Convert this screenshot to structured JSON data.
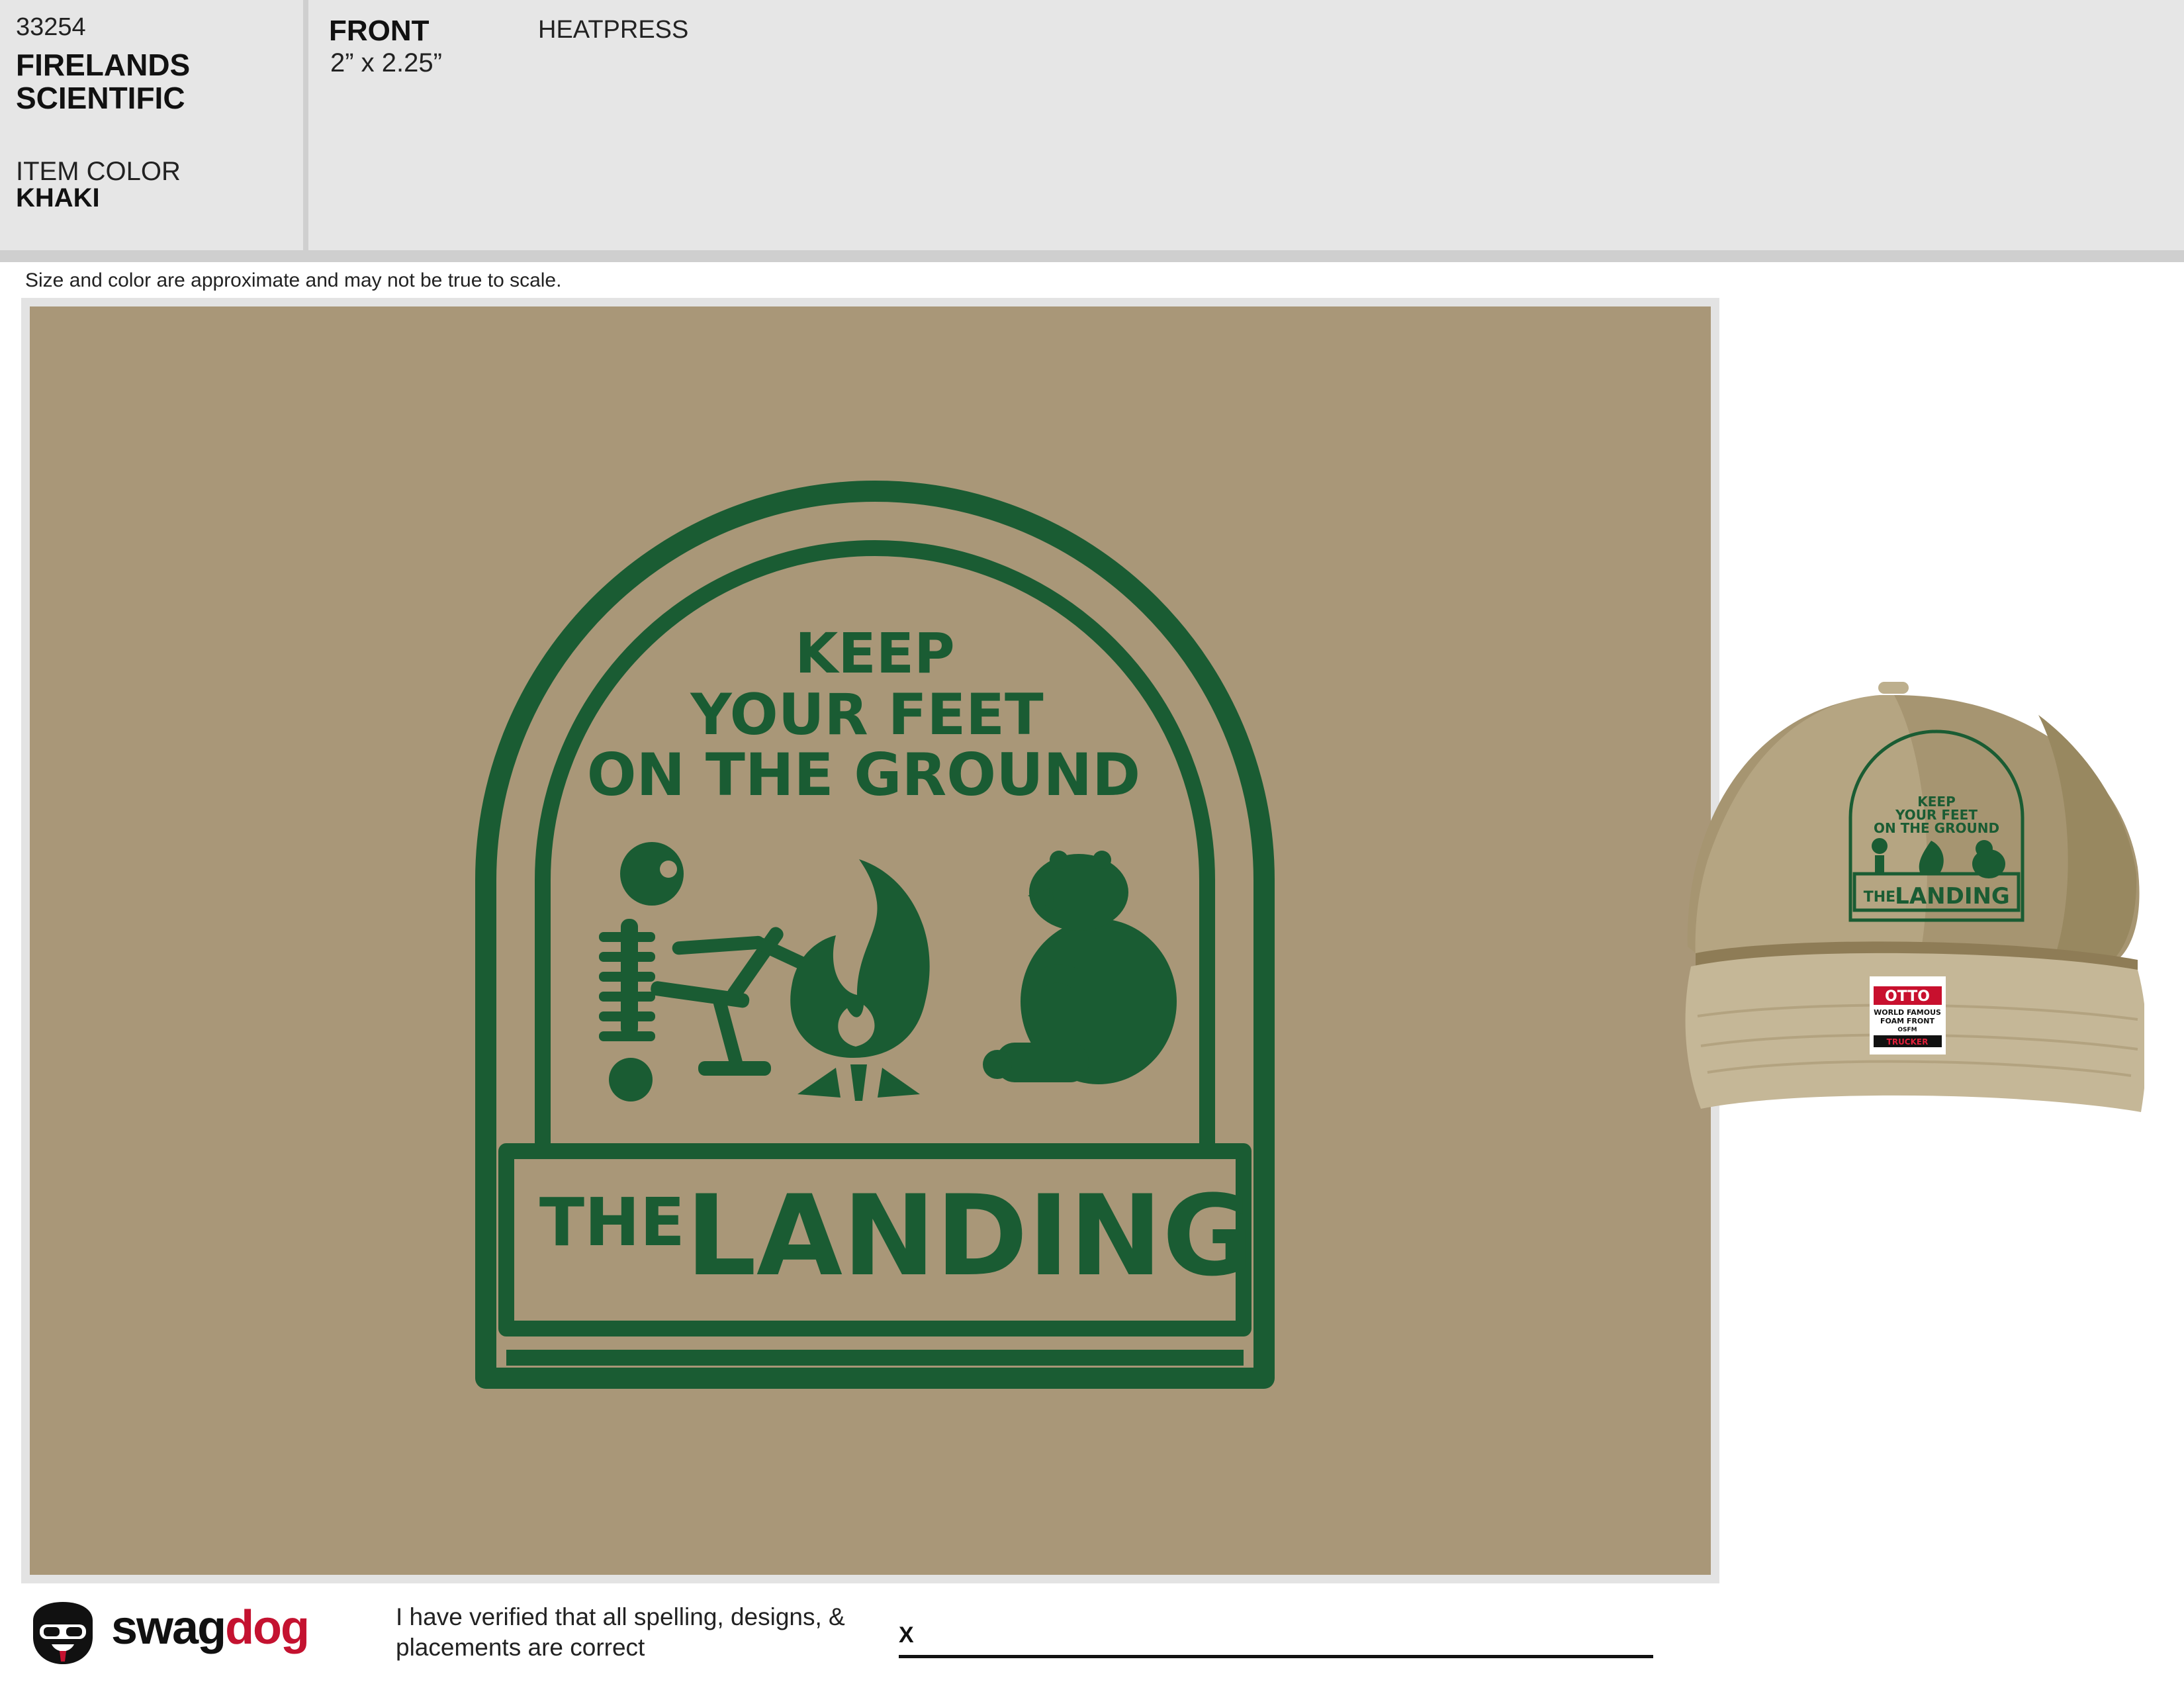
{
  "header": {
    "order_number": "33254",
    "client_name": "FIRELANDS SCIENTIFIC",
    "item_color_label": "ITEM COLOR",
    "item_color_value": "KHAKI",
    "location_label": "FRONT",
    "location_size": "2” x 2.25”",
    "decoration_method": "HEATPRESS"
  },
  "disclaimer": "Size and color are approximate and may not be true to scale.",
  "design": {
    "line1": "KEEP",
    "line2": "YOUR FEET",
    "line3": "ON THE GROUND",
    "banner_small": "THE",
    "banner_large": "LANDING",
    "ink_color": "#1a5c33",
    "background_color": "#a99778"
  },
  "hat_label": {
    "brand": "OTTO",
    "line1": "WORLD FAMOUS",
    "line2": "FOAM FRONT",
    "line3": "OSFM",
    "style": "TRUCKER"
  },
  "footer": {
    "brand_left": "swag",
    "brand_right": "dog",
    "verification_text": "I have verified that all spelling, designs, & placements are correct",
    "signature_mark": "X"
  }
}
